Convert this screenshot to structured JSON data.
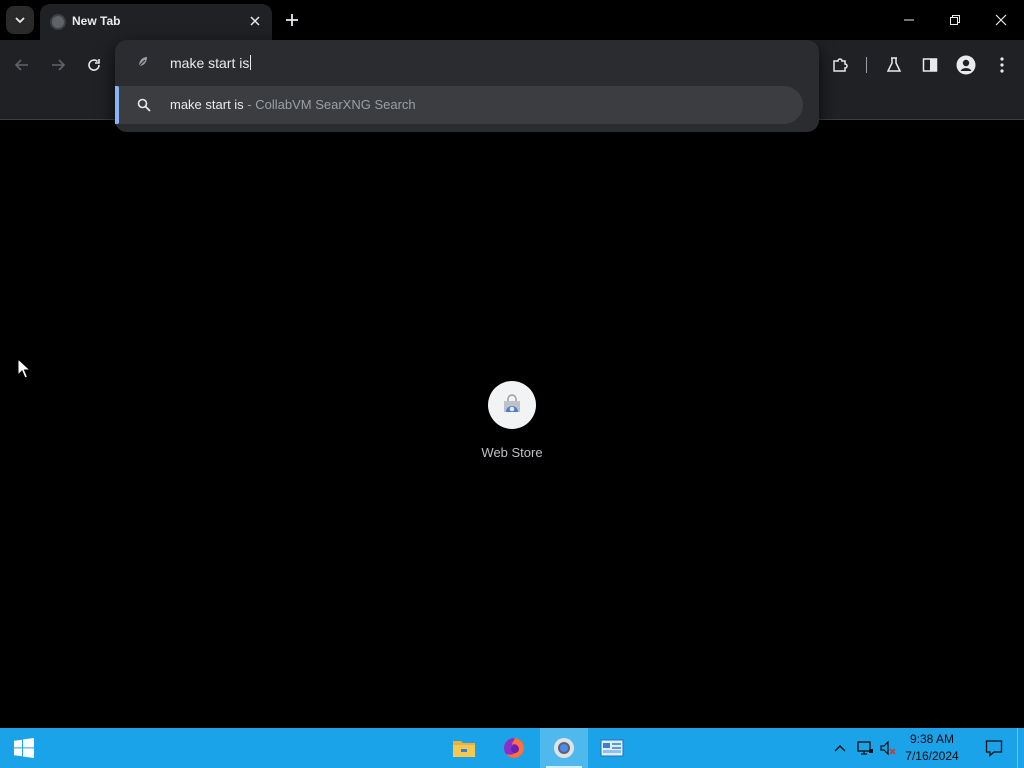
{
  "browser": {
    "tab": {
      "title": "New Tab"
    },
    "omnibox": {
      "input_value": "make start is",
      "suggestion": {
        "query": "make start is",
        "separator": " - ",
        "engine": "CollabVM SearXNG Search"
      }
    }
  },
  "content": {
    "shortcuts": [
      {
        "label": "Web Store",
        "icon": "web-store-icon"
      }
    ]
  },
  "taskbar": {
    "apps": [
      {
        "name": "file-explorer",
        "icon": "folder-icon"
      },
      {
        "name": "firefox",
        "icon": "firefox-icon"
      },
      {
        "name": "chrome",
        "icon": "chrome-icon",
        "active": true
      },
      {
        "name": "control-panel",
        "icon": "control-panel-icon"
      }
    ],
    "clock": {
      "time": "9:38 AM",
      "date": "7/16/2024"
    }
  },
  "colors": {
    "accent": "#8ab4f8",
    "taskbar": "#1aa3e8",
    "toolbar": "#202124"
  }
}
